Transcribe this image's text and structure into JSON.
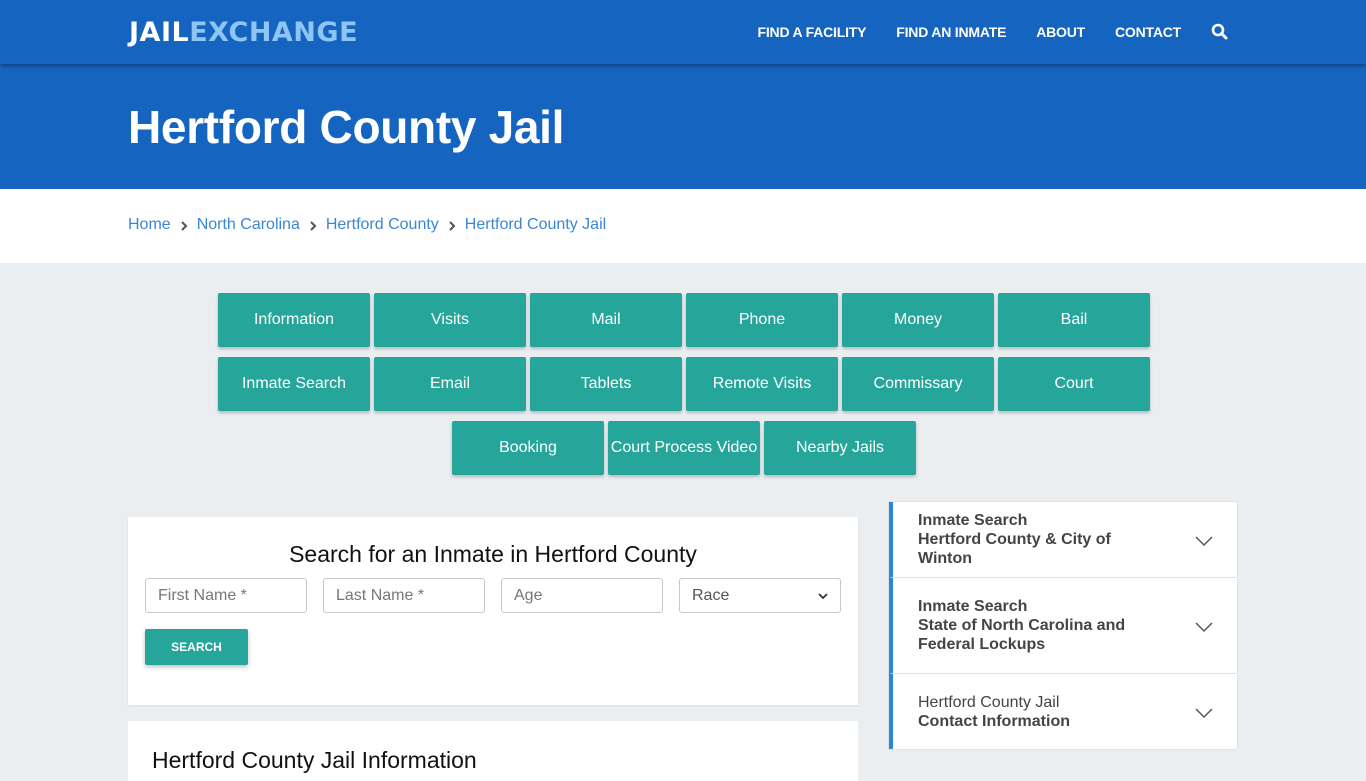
{
  "header": {
    "logo_part1": "JAIL",
    "logo_part2": "EXCHANGE",
    "nav": [
      "FIND A FACILITY",
      "FIND AN INMATE",
      "ABOUT",
      "CONTACT"
    ],
    "search_icon": "search-icon"
  },
  "page": {
    "title": "Hertford County Jail"
  },
  "breadcrumb": [
    "Home",
    "North Carolina",
    "Hertford County",
    "Hertford County Jail"
  ],
  "tabs": [
    "Information",
    "Visits",
    "Mail",
    "Phone",
    "Money",
    "Bail",
    "Inmate Search",
    "Email",
    "Tablets",
    "Remote Visits",
    "Commissary",
    "Court",
    "Booking",
    "Court Process Video",
    "Nearby Jails"
  ],
  "search": {
    "title": "Search for an Inmate in Hertford County",
    "first_name_placeholder": "First Name *",
    "last_name_placeholder": "Last Name *",
    "age_placeholder": "Age",
    "race_selected": "Race",
    "button": "SEARCH"
  },
  "info": {
    "title": "Hertford County Jail Information"
  },
  "sidebar": {
    "items": [
      {
        "line1": "Inmate Search",
        "line2": "Hertford County & City of Winton"
      },
      {
        "line1": "Inmate Search",
        "line2": "State of North Carolina and Federal Lockups"
      },
      {
        "line1": "Hertford County Jail",
        "line2": "Contact Information"
      }
    ]
  },
  "colors": {
    "brand_blue": "#1565c0",
    "teal": "#26a69a",
    "link": "#3a87d5",
    "accent_border": "#2a86d6"
  }
}
